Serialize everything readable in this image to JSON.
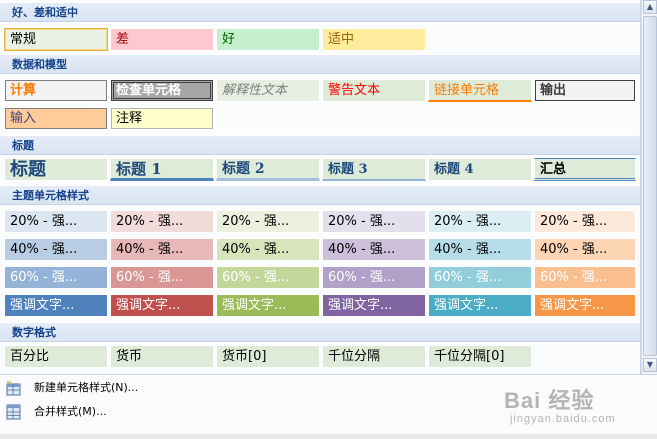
{
  "sections": {
    "good_bad_neutral": "好、差和适中",
    "data_model": "数据和模型",
    "titles": "标题",
    "theme_styles": "主题单元格样式",
    "number_format": "数字格式"
  },
  "good_bad_neutral": [
    "常规",
    "差",
    "好",
    "适中"
  ],
  "data_model_row1": [
    "计算",
    "检查单元格",
    "解释性文本",
    "警告文本",
    "链接单元格",
    "输出"
  ],
  "data_model_row2": [
    "输入",
    "注释"
  ],
  "titles": [
    "标题",
    "标题 1",
    "标题 2",
    "标题 3",
    "标题 4",
    "汇总"
  ],
  "theme_styles": {
    "row20": [
      "20% - 强...",
      "20% - 强...",
      "20% - 强...",
      "20% - 强...",
      "20% - 强...",
      "20% - 强..."
    ],
    "row40": [
      "40% - 强...",
      "40% - 强...",
      "40% - 强...",
      "40% - 强...",
      "40% - 强...",
      "40% - 强..."
    ],
    "row60": [
      "60% - 强...",
      "60% - 强...",
      "60% - 强...",
      "60% - 强...",
      "60% - 强...",
      "60% - 强..."
    ],
    "accent": [
      "强调文字...",
      "强调文字...",
      "强调文字...",
      "强调文字...",
      "强调文字...",
      "强调文字..."
    ]
  },
  "number_format": [
    "百分比",
    "货币",
    "货币[0]",
    "千位分隔",
    "千位分隔[0]"
  ],
  "menu": {
    "new_style": "新建单元格样式(N)...",
    "merge_styles": "合并样式(M)..."
  },
  "watermark": {
    "brand": "Bai 经验",
    "url": "jingyan.baidu.com"
  },
  "colors": {
    "section_header_text": "#15428b",
    "good_fill": "#c6efce",
    "bad_fill": "#ffc7ce",
    "neutral_fill": "#ffeb9c",
    "accent1": "#4f81bd",
    "accent2": "#c0504d",
    "accent3": "#9bbb59",
    "accent4": "#8064a2",
    "accent5": "#4bacc6",
    "accent6": "#f79646"
  }
}
